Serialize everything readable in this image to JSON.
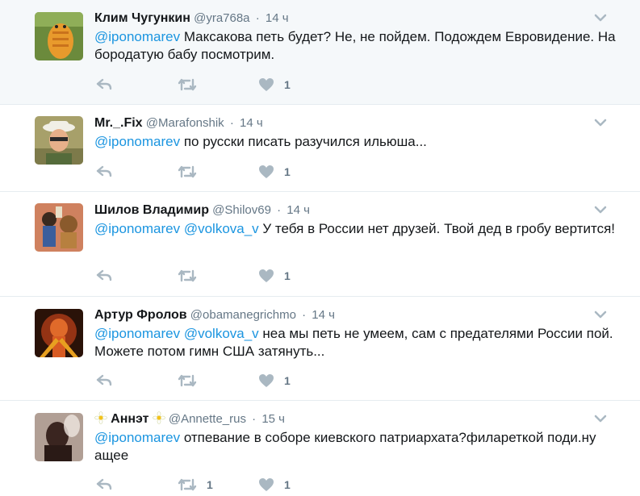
{
  "tweets": [
    {
      "name": "Клим Чугункин",
      "handle": "@yra768a",
      "time": "14 ч",
      "mention1": "@iponomarev",
      "mention2": "",
      "text": " Максакова петь будет? Не, не пойдем. Подождем Евровидение. На бородатую бабу посмотрим.",
      "retweets": "",
      "likes": "1"
    },
    {
      "name": "Mr._.Fix",
      "handle": "@Marafonshik",
      "time": "14 ч",
      "mention1": "@iponomarev",
      "mention2": "",
      "text": " по русски писать разучился ильюша...",
      "retweets": "",
      "likes": "1"
    },
    {
      "name": "Шилов Владимир",
      "handle": "@Shilov69",
      "time": "14 ч",
      "mention1": "@iponomarev",
      "mention2": "@volkova_v",
      "text": " У тебя в России нет друзей. Твой дед в гробу вертится!",
      "retweets": "",
      "likes": "1"
    },
    {
      "name": "Артур Фролов",
      "handle": "@obamanegrichmo",
      "time": "14 ч",
      "mention1": "@iponomarev",
      "mention2": "@volkova_v",
      "text": " неа мы петь не умеем, сам с предателями России пой. Можете потом гимн США затянуть...",
      "retweets": "",
      "likes": "1"
    },
    {
      "name": "Аннэт",
      "handle": "@Annette_rus",
      "time": "15 ч",
      "mention1": "@iponomarev",
      "mention2": "",
      "text": " отпевание в соборе киевского патриархата?филареткой поди.ну ащее",
      "retweets": "1",
      "likes": "1"
    }
  ],
  "separator": "·",
  "icons": {
    "reply": "reply-icon",
    "retweet": "retweet-icon",
    "like": "heart-icon",
    "more": "chevron-down-icon",
    "flower": "daisy-emoji-icon"
  },
  "colors": {
    "text": "#14171a",
    "secondary": "#657786",
    "link": "#1b95e0",
    "icon": "#aab8c2",
    "highlight_bg": "#f5f8fa",
    "border": "#e6ecf0"
  }
}
